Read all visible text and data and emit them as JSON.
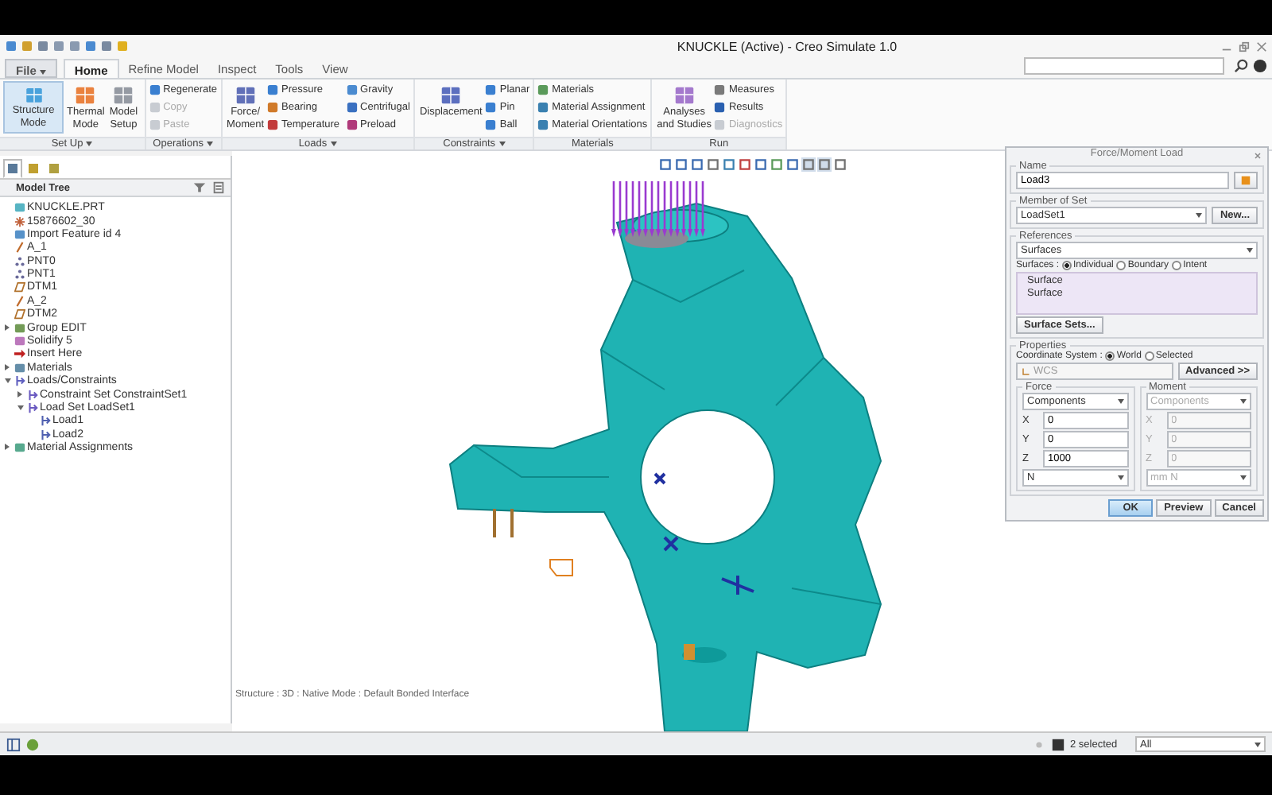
{
  "window": {
    "title": "KNUCKLE (Active) - Creo Simulate 1.0"
  },
  "tabs": [
    {
      "label": "File",
      "kind": "menu",
      "selected": false
    },
    {
      "label": "Home",
      "kind": "tab",
      "selected": true
    },
    {
      "label": "Refine Model",
      "kind": "tab",
      "selected": false
    },
    {
      "label": "Inspect",
      "kind": "tab",
      "selected": false
    },
    {
      "label": "Tools",
      "kind": "tab",
      "selected": false
    },
    {
      "label": "View",
      "kind": "tab",
      "selected": false
    }
  ],
  "ribbon": [
    {
      "label": "Set Up",
      "has_menu": true,
      "items": [
        {
          "label": "Structure\nMode",
          "kind": "large",
          "selected": true,
          "disabled": false
        },
        {
          "label": "Thermal\nMode",
          "kind": "large",
          "selected": false,
          "disabled": false
        },
        {
          "label": "Model\nSetup",
          "kind": "large",
          "selected": false,
          "disabled": false
        }
      ]
    },
    {
      "label": "Operations",
      "has_menu": true,
      "items": [
        {
          "label": "Regenerate",
          "kind": "small",
          "disabled": false
        },
        {
          "label": "Copy",
          "kind": "small",
          "disabled": true
        },
        {
          "label": "Paste",
          "kind": "small",
          "disabled": true
        }
      ]
    },
    {
      "label": "Loads",
      "has_menu": true,
      "items": [
        {
          "label": "Force/\nMoment",
          "kind": "large",
          "selected": false,
          "disabled": false
        },
        {
          "label": "Pressure",
          "kind": "small",
          "disabled": false
        },
        {
          "label": "Bearing",
          "kind": "small",
          "disabled": false
        },
        {
          "label": "Temperature",
          "kind": "small",
          "disabled": false
        },
        {
          "label": "Gravity",
          "kind": "small",
          "disabled": false
        },
        {
          "label": "Centrifugal",
          "kind": "small",
          "disabled": false
        },
        {
          "label": "Preload",
          "kind": "small",
          "disabled": false
        }
      ]
    },
    {
      "label": "Constraints",
      "has_menu": true,
      "items": [
        {
          "label": "Displacement",
          "kind": "large",
          "selected": false,
          "disabled": false
        },
        {
          "label": "Planar",
          "kind": "small",
          "disabled": false
        },
        {
          "label": "Pin",
          "kind": "small",
          "disabled": false
        },
        {
          "label": "Ball",
          "kind": "small",
          "disabled": false
        }
      ]
    },
    {
      "label": "Materials",
      "has_menu": false,
      "items": [
        {
          "label": "Materials",
          "kind": "small",
          "disabled": false
        },
        {
          "label": "Material Assignment",
          "kind": "small",
          "disabled": false
        },
        {
          "label": "Material Orientations",
          "kind": "small",
          "disabled": false
        }
      ]
    },
    {
      "label": "Run",
      "has_menu": false,
      "items": [
        {
          "label": "Analyses\nand Studies",
          "kind": "large",
          "selected": false,
          "disabled": false
        },
        {
          "label": "Measures",
          "kind": "small",
          "disabled": false
        },
        {
          "label": "Results",
          "kind": "small",
          "disabled": false
        },
        {
          "label": "Diagnostics",
          "kind": "small",
          "disabled": true
        }
      ]
    }
  ],
  "navigator_tabs": [
    {
      "selected": true
    },
    {
      "selected": false
    },
    {
      "selected": false
    }
  ],
  "model_tree": {
    "title": "Model Tree",
    "items": [
      {
        "label": "KNUCKLE.PRT",
        "kind": "part"
      },
      {
        "label": "15876602_30",
        "kind": "coord"
      },
      {
        "label": "Import Feature id 4",
        "kind": "import"
      },
      {
        "label": "A_1",
        "kind": "axis"
      },
      {
        "label": "PNT0",
        "kind": "point"
      },
      {
        "label": "PNT1",
        "kind": "point"
      },
      {
        "label": "DTM1",
        "kind": "plane"
      },
      {
        "label": "A_2",
        "kind": "axis"
      },
      {
        "label": "DTM2",
        "kind": "plane"
      },
      {
        "label": "Group EDIT",
        "kind": "group",
        "expanded": false
      },
      {
        "label": "Solidify 5",
        "kind": "solidify"
      },
      {
        "label": "Insert Here",
        "kind": "insert"
      },
      {
        "label": "Materials",
        "kind": "materials",
        "expanded": false
      },
      {
        "label": "Loads/Constraints",
        "kind": "loads",
        "expanded": true,
        "children": [
          {
            "label": "Constraint Set ConstraintSet1",
            "kind": "set",
            "expanded": false
          },
          {
            "label": "Load Set LoadSet1",
            "kind": "set",
            "expanded": true,
            "children": [
              {
                "label": "Load1",
                "kind": "load"
              },
              {
                "label": "Load2",
                "kind": "load"
              }
            ]
          }
        ]
      },
      {
        "label": "Material Assignments",
        "kind": "assignment",
        "expanded": false
      }
    ]
  },
  "viewport": {
    "status": "Structure : 3D : Native Mode : Default Bonded Interface"
  },
  "dialog": {
    "title": "Force/Moment Load",
    "name": {
      "heading": "Name",
      "value": "Load3"
    },
    "member_of_set": {
      "heading": "Member of Set",
      "value": "LoadSet1",
      "button": "New..."
    },
    "references": {
      "heading": "References",
      "type": "Surfaces",
      "selection_label": "Surfaces :",
      "options": [
        {
          "label": "Individual",
          "selected": true
        },
        {
          "label": "Boundary",
          "selected": false
        },
        {
          "label": "Intent",
          "selected": false
        }
      ],
      "items": [
        "Surface",
        "Surface"
      ],
      "button": "Surface Sets..."
    },
    "properties": {
      "heading": "Properties",
      "coord_label": "Coordinate System :",
      "coord_options": [
        {
          "label": "World",
          "selected": true
        },
        {
          "label": "Selected",
          "selected": false
        }
      ],
      "coord_value": "WCS",
      "button": "Advanced >>"
    },
    "force": {
      "heading": "Force",
      "mode": "Components",
      "disabled": false,
      "fields": [
        {
          "axis": "X",
          "value": "0"
        },
        {
          "axis": "Y",
          "value": "0"
        },
        {
          "axis": "Z",
          "value": "1000"
        }
      ],
      "unit": "N"
    },
    "moment": {
      "heading": "Moment",
      "mode": "Components",
      "disabled": true,
      "fields": [
        {
          "axis": "X",
          "value": "0"
        },
        {
          "axis": "Y",
          "value": "0"
        },
        {
          "axis": "Z",
          "value": "0"
        }
      ],
      "unit": "mm N"
    },
    "buttons": [
      {
        "label": "OK",
        "default": true
      },
      {
        "label": "Preview",
        "default": false
      },
      {
        "label": "Cancel",
        "default": false
      }
    ]
  },
  "status_bar": {
    "selection": "2 selected",
    "filter": "All"
  }
}
